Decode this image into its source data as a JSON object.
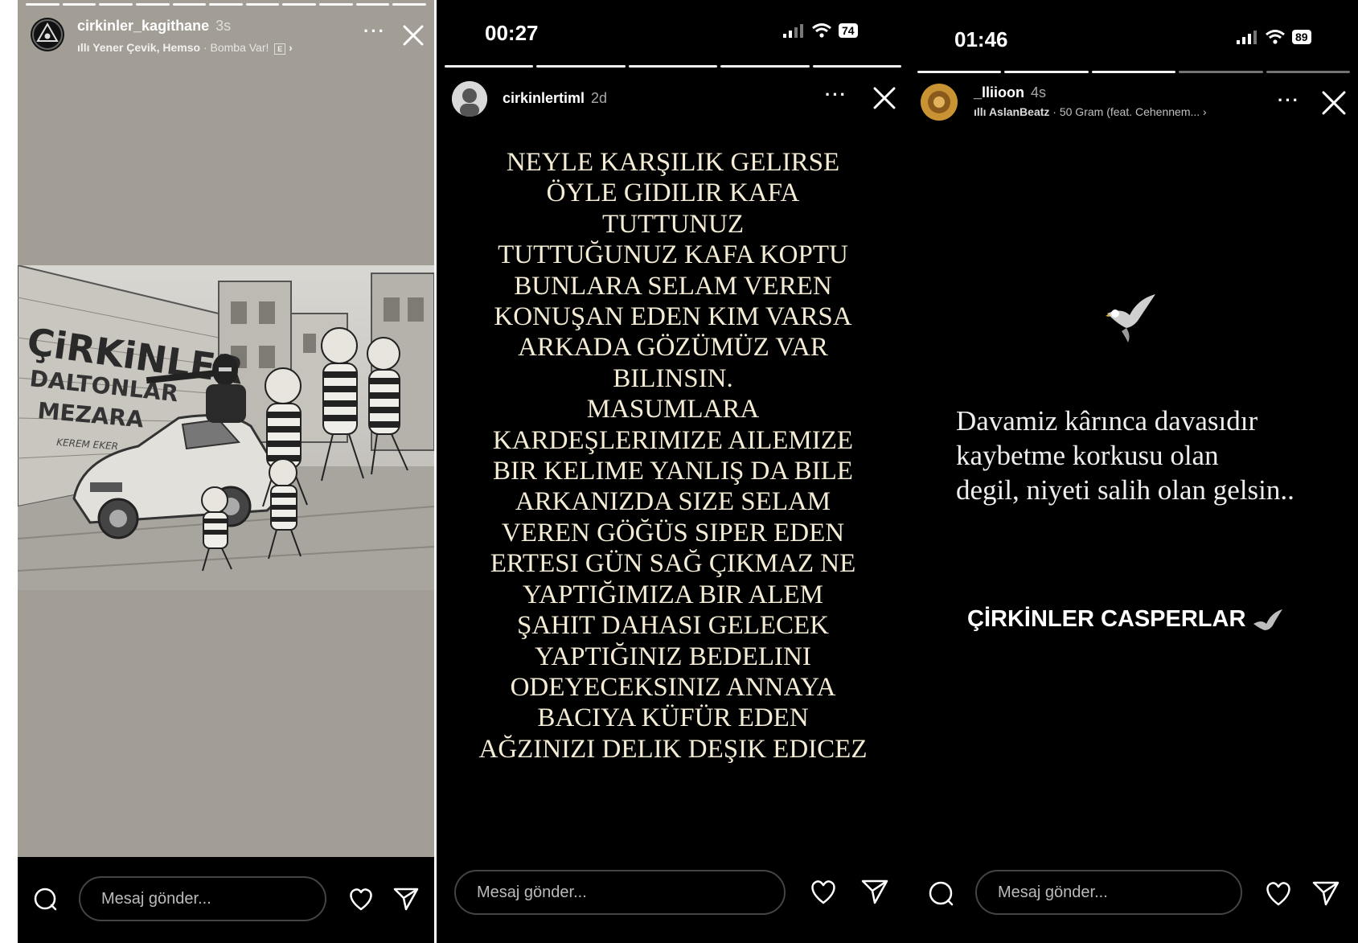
{
  "panel1": {
    "username": "cirkinler_kagithane",
    "time_ago": "3s",
    "music_artists": "Yener Çevik, Hemso",
    "music_title": "· Bomba Var!",
    "artwork": {
      "title": "ÇiRKiNLER",
      "subtitle_1": "DALTONLAR",
      "subtitle_2": "MEZARA",
      "signature": "KEREM EKER"
    },
    "message_placeholder": "Mesaj gönder..."
  },
  "panel2": {
    "status_time": "00:27",
    "battery": "74",
    "username": "cirkinlertiml",
    "time_ago": "2d",
    "lines": [
      "NEYLE KARŞILIK GELIRSE",
      "ÖYLE GIDILIR KAFA",
      "TUTTUNUZ",
      "TUTTUĞUNUZ KAFA KOPTU",
      "BUNLARA SELAM VEREN",
      "KONUŞAN EDEN KIM VARSA",
      "ARKADA GÖZÜMÜZ VAR",
      "BILINSIN.",
      "MASUMLARA",
      "KARDEŞLERIMIZE AILEMIZE",
      "BIR KELIME YANLIŞ DA BILE",
      "ARKANIZDA SIZE SELAM",
      "VEREN GÖĞÜS SIPER EDEN",
      "ERTESI GÜN SAĞ ÇIKMAZ NE",
      "YAPTIĞIMIZA BIR ALEM",
      "ŞAHIT DAHASI GELECEK",
      "YAPTIĞINIZ BEDELINI",
      "ODEYECEKSINIZ ANNAYA",
      "BACIYA KÜFÜR EDEN",
      "AĞZINIZI DELIK DEŞIK EDICEZ"
    ],
    "message_placeholder": "Mesaj gönder..."
  },
  "panel3": {
    "status_time": "01:46",
    "battery": "89",
    "username": "_lliioon",
    "time_ago": "4s",
    "music_artists": "AslanBeatz",
    "music_title": "· 50 Gram (feat. Cehennem... ›",
    "quote_lines": [
      "Davamiz kârınca davasıdır",
      "kaybetme korkusu olan",
      "degil, niyeti salih olan gelsin.."
    ],
    "tagline": "ÇİRKİNLER CASPERLAR",
    "message_placeholder": "Mesaj gönder..."
  },
  "icons": [
    "more-icon",
    "close-icon",
    "camera-icon",
    "heart-icon",
    "send-icon",
    "music-icon",
    "signal-icon",
    "wifi-icon",
    "battery-icon",
    "eagle-icon"
  ]
}
